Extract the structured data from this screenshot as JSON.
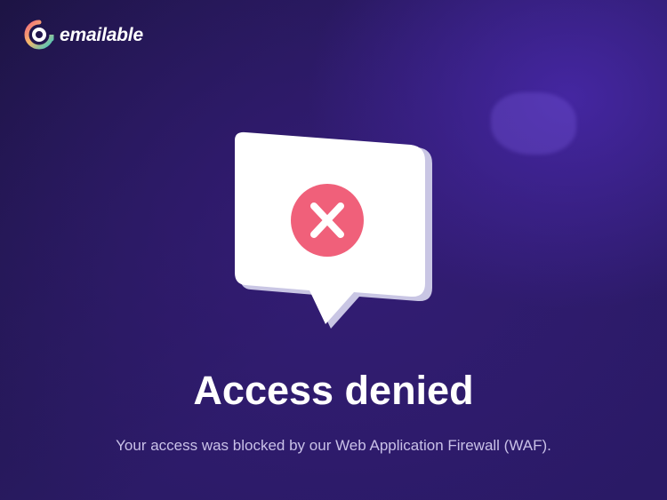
{
  "brand": {
    "name": "emailable",
    "logo_icon": "emailable-at-logo-icon"
  },
  "error": {
    "illustration_icon": "speech-bubble-x-icon",
    "title": "Access denied",
    "message": "Your access was blocked by our Web Application Firewall (WAF)."
  },
  "colors": {
    "background": "#2b1b66",
    "error_accent": "#f0607a",
    "text_primary": "#ffffff",
    "text_secondary": "#c9c1e8"
  }
}
